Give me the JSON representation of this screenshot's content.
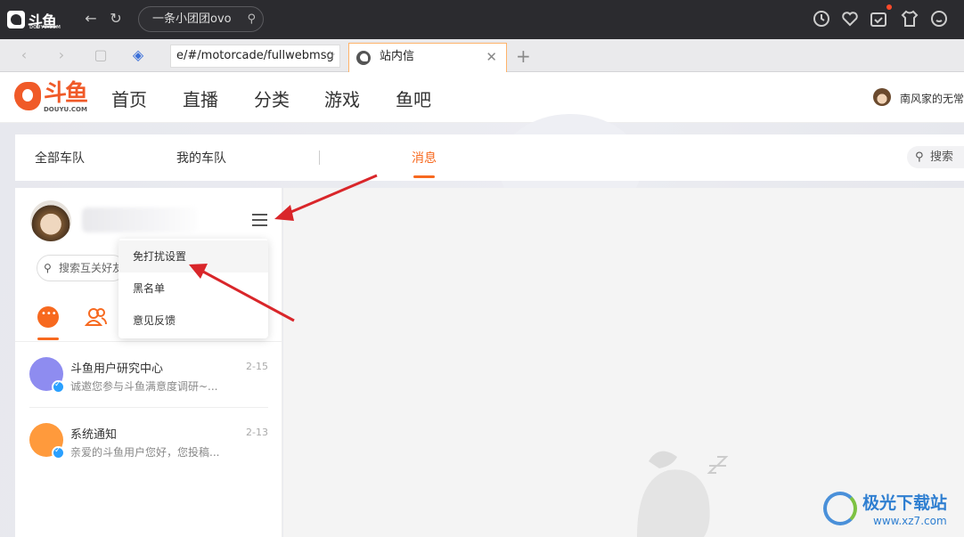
{
  "browser": {
    "brand": "斗鱼",
    "brand_sub": "DOUYU.COM",
    "omnibox_text": "一条小团团ovo",
    "address_url": "e/#/motorcade/fullwebmsg",
    "active_tab_title": "站内信"
  },
  "site": {
    "logo_text": "斗鱼",
    "logo_domain": "DOUYU.COM",
    "nav": [
      "首页",
      "直播",
      "分类",
      "游戏",
      "鱼吧"
    ],
    "username": "南风家的无常"
  },
  "subnav": {
    "items": [
      "全部车队",
      "我的车队"
    ],
    "active": "消息",
    "search_placeholder": "搜索"
  },
  "panel": {
    "search_placeholder": "搜索互关好友",
    "dropdown": [
      "免打扰设置",
      "黑名单",
      "意见反馈"
    ],
    "messages": [
      {
        "title": "斗鱼用户研究中心",
        "preview": "诚邀您参与斗鱼满意度调研~...",
        "date": "2-15"
      },
      {
        "title": "系统通知",
        "preview": "亲爱的斗鱼用户您好，您投稿...",
        "date": "2-13"
      }
    ]
  },
  "watermark": {
    "name": "极光下载站",
    "url": "www.xz7.com"
  },
  "colors": {
    "accent": "#f7691f",
    "annotation_arrow": "#d9262a"
  }
}
